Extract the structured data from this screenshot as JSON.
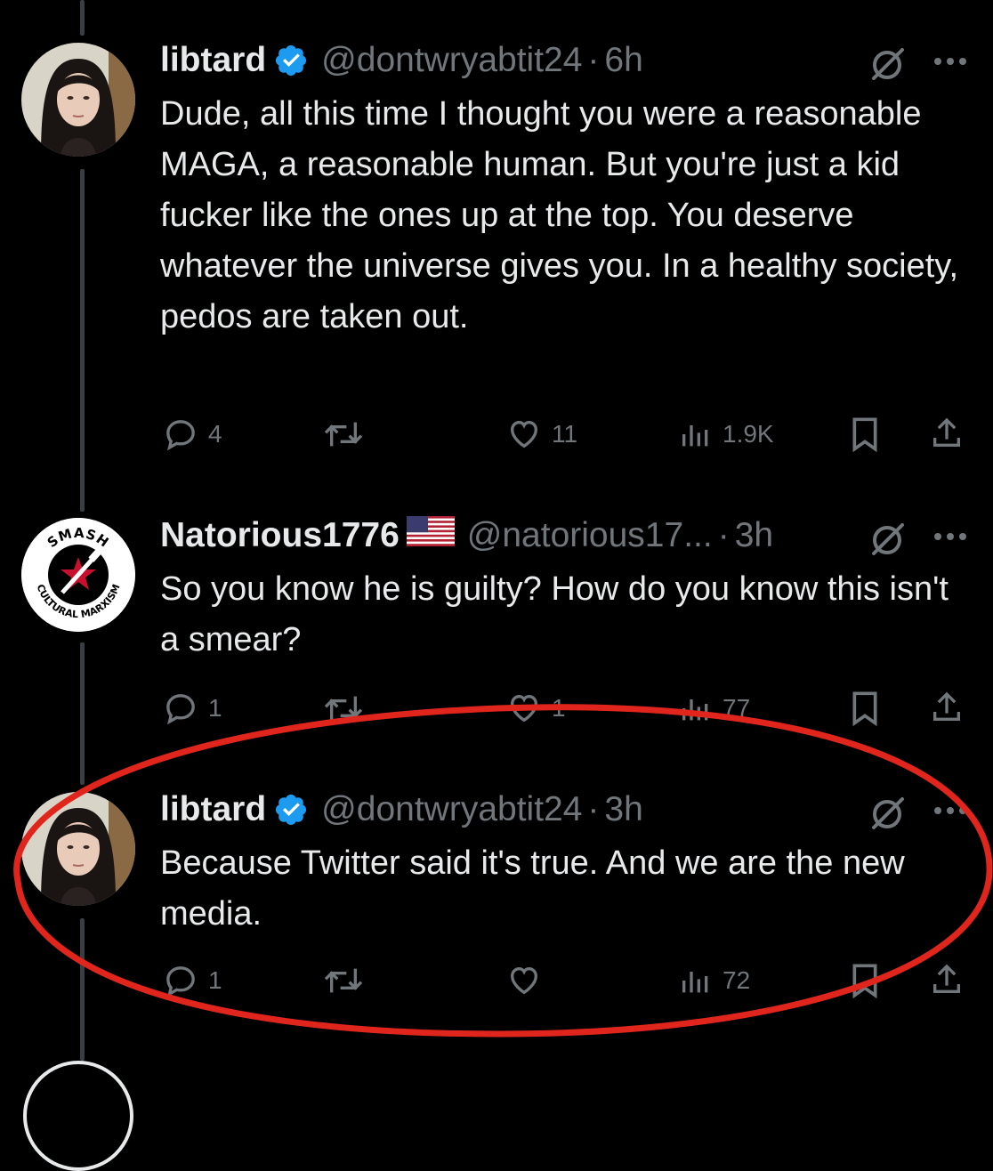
{
  "tweets": [
    {
      "name": "libtard",
      "verified": true,
      "handle": "@dontwryabtit24",
      "dot": "·",
      "time": "6h",
      "text": "Dude, all this time I thought you were a reasonable MAGA, a reasonable human. But you're just a kid fucker like the ones up at the top. You deserve whatever the universe gives you. In a healthy society, pedos are taken out.",
      "replies": "4",
      "retweets": "",
      "likes": "11",
      "views": "1.9K"
    },
    {
      "name": "Natorious1776",
      "flag": "🇺🇸",
      "handle": "@natorious17...",
      "dot": "·",
      "time": "3h",
      "text": "So you know he is guilty? How do you know this isn't a smear?",
      "replies": "1",
      "retweets": "",
      "likes": "1",
      "views": "77",
      "avatar_text_top": "SMASH",
      "avatar_text_bottom": "CULTURAL MARXISM"
    },
    {
      "name": "libtard",
      "verified": true,
      "handle": "@dontwryabtit24",
      "dot": "·",
      "time": "3h",
      "text": "Because Twitter said it's true. And we are the new media.",
      "replies": "1",
      "retweets": "",
      "likes": "",
      "views": "72"
    }
  ],
  "colors": {
    "background": "#000000",
    "text": "#e7e9ea",
    "muted": "#71767b",
    "verified": "#1d9bf0",
    "annotation": "#e0261c"
  }
}
